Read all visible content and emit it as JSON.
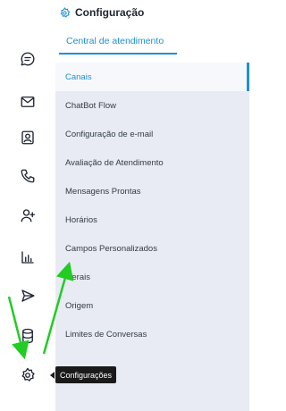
{
  "header": {
    "title": "Configuração",
    "icon": "gear-icon",
    "accent": "#1e90d6"
  },
  "tabs": [
    {
      "label": "Central de atendimento",
      "active": true
    }
  ],
  "menu": {
    "items": [
      {
        "label": "Canais",
        "active": true
      },
      {
        "label": "ChatBot Flow"
      },
      {
        "label": "Configuração de e-mail"
      },
      {
        "label": "Avaliação de Atendimento"
      },
      {
        "label": "Mensagens Prontas"
      },
      {
        "label": "Horários"
      },
      {
        "label": "Campos Personalizados"
      },
      {
        "label": "Gerais"
      },
      {
        "label": "Origem"
      },
      {
        "label": "Limites de Conversas"
      }
    ]
  },
  "rail": {
    "icons": [
      "chat-icon",
      "mail-icon",
      "contact-card-icon",
      "phone-icon",
      "add-user-icon",
      "bar-chart-icon",
      "send-icon",
      "database-icon",
      "gear-icon"
    ]
  },
  "tooltip": {
    "text": "Configurações"
  },
  "annotation_color": "#22cc22"
}
